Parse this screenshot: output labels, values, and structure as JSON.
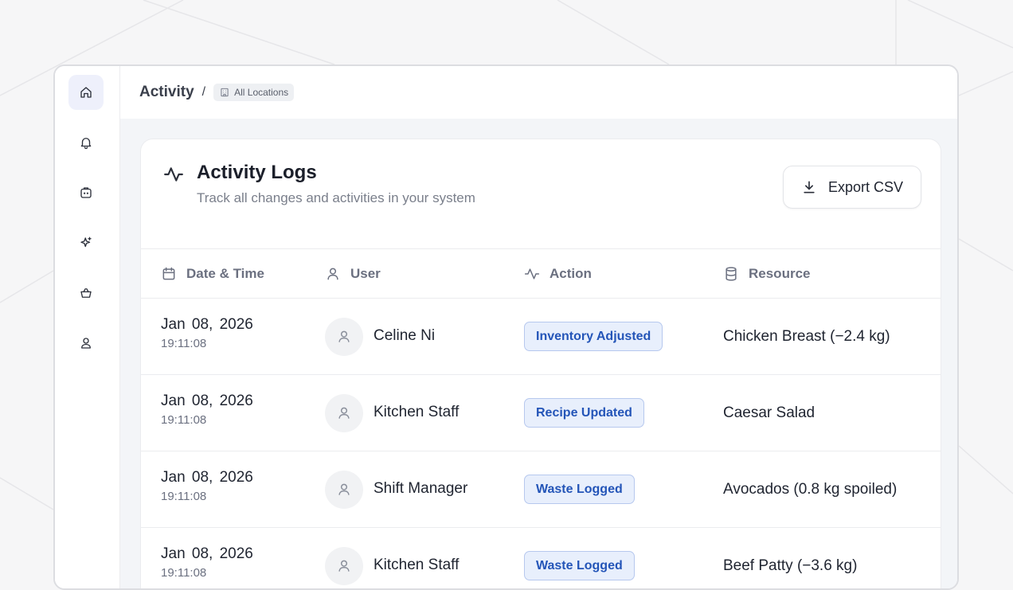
{
  "breadcrumb": {
    "title": "Activity",
    "separator": "/",
    "location_badge": "All Locations"
  },
  "sidebar": {
    "items": [
      {
        "name": "home",
        "icon": "home-icon",
        "active": true
      },
      {
        "name": "notifications",
        "icon": "bell-icon",
        "active": false
      },
      {
        "name": "inventory",
        "icon": "box-icon",
        "active": false
      },
      {
        "name": "ai",
        "icon": "sparkle-icon",
        "active": false
      },
      {
        "name": "orders",
        "icon": "basket-icon",
        "active": false
      },
      {
        "name": "profile",
        "icon": "user-icon",
        "active": false
      }
    ]
  },
  "card": {
    "title": "Activity Logs",
    "subtitle": "Track all changes and activities in your system",
    "export_label": "Export CSV"
  },
  "table": {
    "columns": [
      "Date & Time",
      "User",
      "Action",
      "Resource"
    ],
    "rows": [
      {
        "date": "Jan 08, 2026",
        "time": "19:11:08",
        "user": "Celine Ni",
        "action": "Inventory Adjusted",
        "resource": "Chicken Breast (−2.4 kg)"
      },
      {
        "date": "Jan 08, 2026",
        "time": "19:11:08",
        "user": "Kitchen Staff",
        "action": "Recipe Updated",
        "resource": "Caesar Salad"
      },
      {
        "date": "Jan 08, 2026",
        "time": "19:11:08",
        "user": "Shift Manager",
        "action": "Waste Logged",
        "resource": "Avocados (0.8 kg spoiled)"
      },
      {
        "date": "Jan 08, 2026",
        "time": "19:11:08",
        "user": "Kitchen Staff",
        "action": "Waste Logged",
        "resource": "Beef Patty (−3.6 kg)"
      }
    ]
  },
  "colors": {
    "badge_bg": "#e8effc",
    "badge_border": "#b6c8ee",
    "badge_text": "#2455b8",
    "active_nav": "#eef0fb"
  }
}
